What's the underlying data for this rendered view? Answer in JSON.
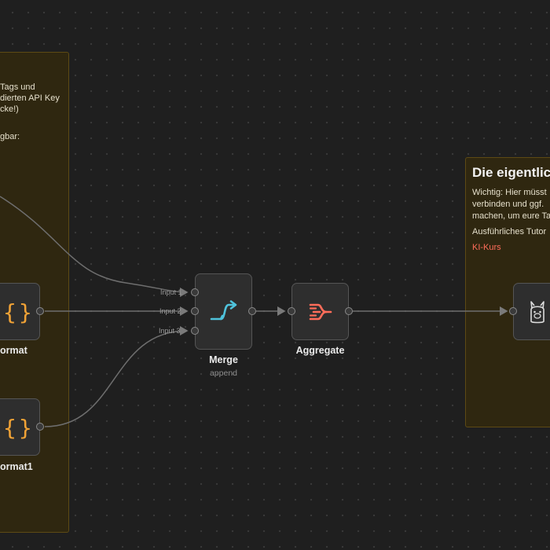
{
  "canvas": {
    "colors": {
      "background": "#1f1f1f",
      "sticky_fill": "#2f2710",
      "accent_link": "#ff6d5a",
      "merge_icon": "#4fc3dc",
      "aggregate_icon": "#ff6d5a",
      "format_icon": "#f0a236"
    }
  },
  "sticky_left": {
    "line1": "Tags und",
    "line2": "dierten API Key",
    "line3": "cke!)",
    "line4": "gbar:"
  },
  "sticky_right": {
    "heading": "Die eigentlic",
    "line1": "Wichtig: Hier müsst",
    "line2": "verbinden und ggf.",
    "line3": "machen, um eure Ta",
    "line4": "Ausführliches Tutor",
    "link": "KI-Kurs"
  },
  "nodes": {
    "format": {
      "label": "ormat",
      "icon": "curly-braces-icon"
    },
    "format1": {
      "label": "ormat1",
      "icon": "curly-braces-icon"
    },
    "merge": {
      "label": "Merge",
      "subtitle": "append",
      "icon": "merge-icon",
      "inputs": [
        "Input 1",
        "Input 2",
        "Input 3"
      ]
    },
    "aggregate": {
      "label": "Aggregate",
      "icon": "aggregate-icon"
    },
    "ollama": {
      "icon": "llama-icon"
    }
  }
}
